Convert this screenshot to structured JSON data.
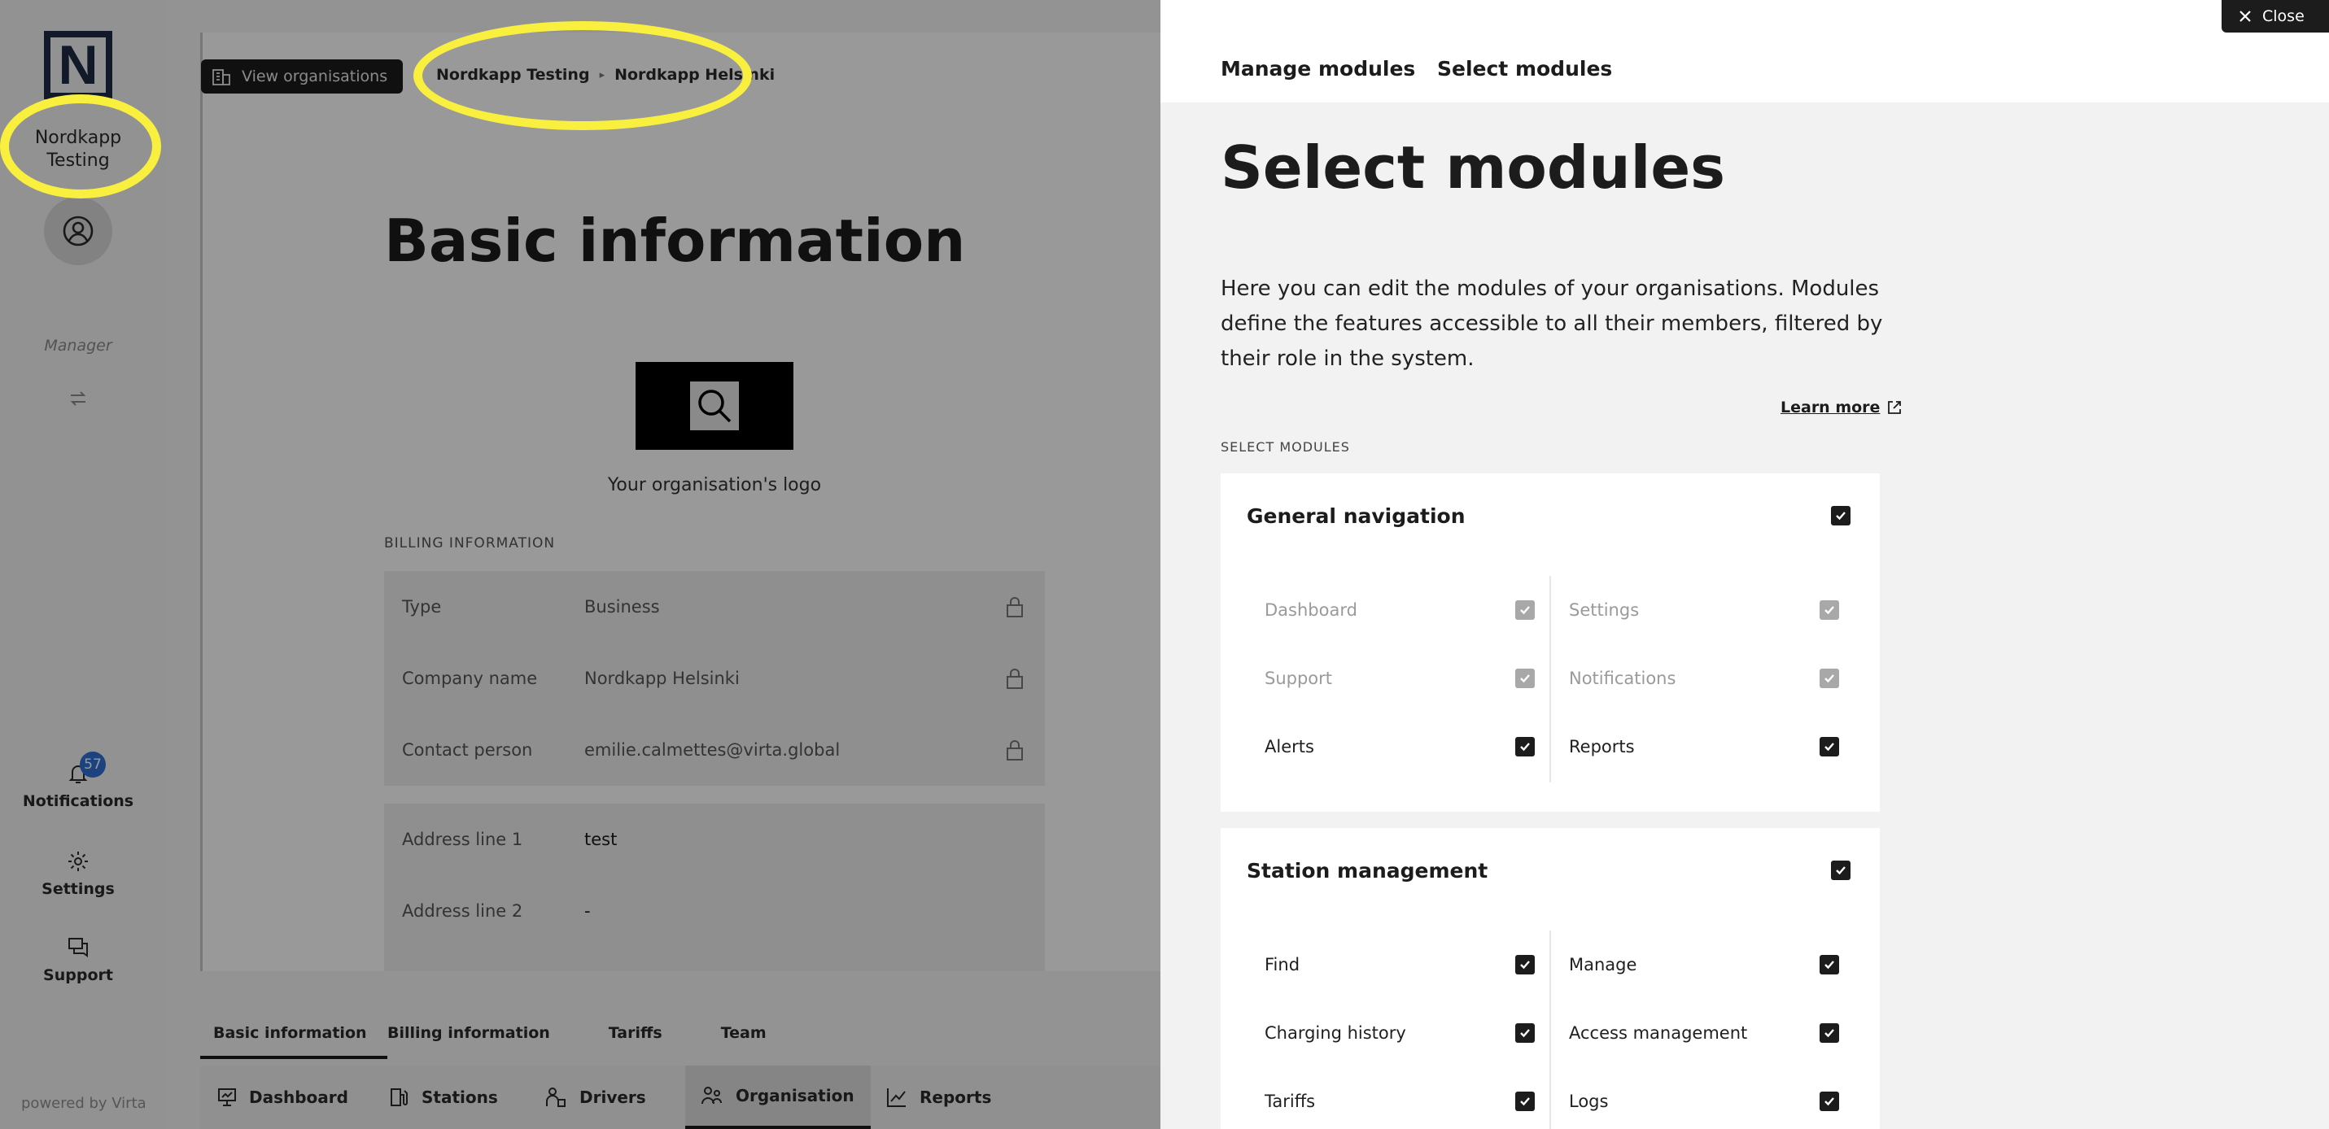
{
  "sidebar": {
    "logo_letter": "N",
    "org_name_line1": "Nordkapp",
    "org_name_line2": "Testing",
    "role": "Manager",
    "notifications_label": "Notifications",
    "notifications_count": "57",
    "settings_label": "Settings",
    "support_label": "Support",
    "powered_by": "powered by Virta"
  },
  "main": {
    "view_orgs_label": "View organisations",
    "breadcrumb": [
      "Nordkapp Testing",
      "Nordkapp Helsinki"
    ],
    "title": "Basic information",
    "logo_caption": "Your organisation's logo",
    "billing_section_label": "BILLING INFORMATION",
    "billing_rows": [
      {
        "key": "Type",
        "value": "Business"
      },
      {
        "key": "Company name",
        "value": "Nordkapp Helsinki"
      },
      {
        "key": "Contact person",
        "value": "emilie.calmettes@virta.global"
      }
    ],
    "address_rows": [
      {
        "key": "Address line 1",
        "value": "test"
      },
      {
        "key": "Address line 2",
        "value": "-"
      }
    ],
    "sub_tabs": [
      "Basic information",
      "Billing information",
      "Tariffs",
      "Team"
    ],
    "bottom_nav": [
      "Dashboard",
      "Stations",
      "Drivers",
      "Organisation",
      "Reports"
    ]
  },
  "drawer": {
    "close_label": "Close",
    "tabs": [
      "Manage modules",
      "Select modules"
    ],
    "title": "Select modules",
    "description": "Here you can edit the modules of your organisations. Modules define the features accessible to all their members, filtered by their role in the system.",
    "learn_more": "Learn more",
    "section_label": "SELECT MODULES",
    "groups": [
      {
        "name": "General navigation",
        "items": [
          "Dashboard",
          "Settings",
          "Support",
          "Notifications",
          "Alerts",
          "Reports"
        ]
      },
      {
        "name": "Station management",
        "items": [
          "Find",
          "Manage",
          "Charging history",
          "Access management",
          "Tariffs",
          "Logs"
        ]
      }
    ]
  },
  "colors": {
    "highlight": "#f9ef3f",
    "badge": "#2f6fd6",
    "dark": "#1c1c1c"
  }
}
